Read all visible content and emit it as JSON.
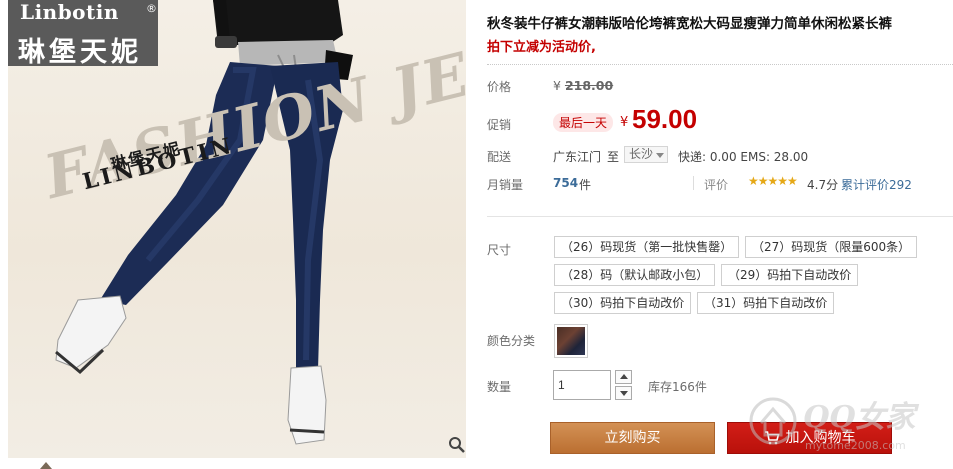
{
  "image": {
    "brand_en": "Linbotin",
    "brand_reg": "®",
    "brand_cn": "琳堡天妮",
    "fashion_text": "FASHION JEAN",
    "mid_brand_en": "LINBOTIN",
    "mid_brand_cn": "琳堡天妮"
  },
  "product": {
    "title": "秋冬装牛仔裤女潮韩版哈伦垮裤宽松大码显瘦弹力简单休闲松紧长裤",
    "subtitle": "拍下立减为活动价,"
  },
  "price": {
    "label": "价格",
    "currency": "¥",
    "original": "218.00"
  },
  "promo": {
    "label": "促销",
    "badge": "最后一天",
    "currency": "¥",
    "price": "59.00"
  },
  "shipping": {
    "label": "配送",
    "from": "广东江门",
    "to_word": "至",
    "city": "长沙",
    "express": "快递: 0.00 EMS: 28.00"
  },
  "sales": {
    "label": "月销量",
    "count": "754",
    "unit": "件",
    "rating_label": "评价",
    "stars": "★★★★★",
    "score": "4.7分",
    "reviews": "累计评价292"
  },
  "sku": {
    "size_label": "尺寸",
    "sizes": [
      "（26）码现货（第一批快售罄）",
      "（27）码现货（限量600条）",
      "（28）码（默认邮政小包）",
      "（29）码拍下自动改价",
      "（30）码拍下自动改价",
      "（31）码拍下自动改价"
    ],
    "color_label": "颜色分类"
  },
  "quantity": {
    "label": "数量",
    "value": "1",
    "stock": "库存166件"
  },
  "actions": {
    "buy": "立刻购买",
    "cart": "加入购物车"
  },
  "watermark": {
    "text": "QQ女家",
    "url": "mytome2008.com"
  },
  "colors": {
    "accent_red": "#c40000",
    "buy_orange": "#c97f40",
    "cart_red": "#c8170f",
    "link_blue": "#3c6c99"
  },
  "icons": [
    "zoom-icon",
    "cart-icon",
    "arrow-up-icon",
    "arrow-down-icon",
    "dropdown-arrow-icon"
  ]
}
